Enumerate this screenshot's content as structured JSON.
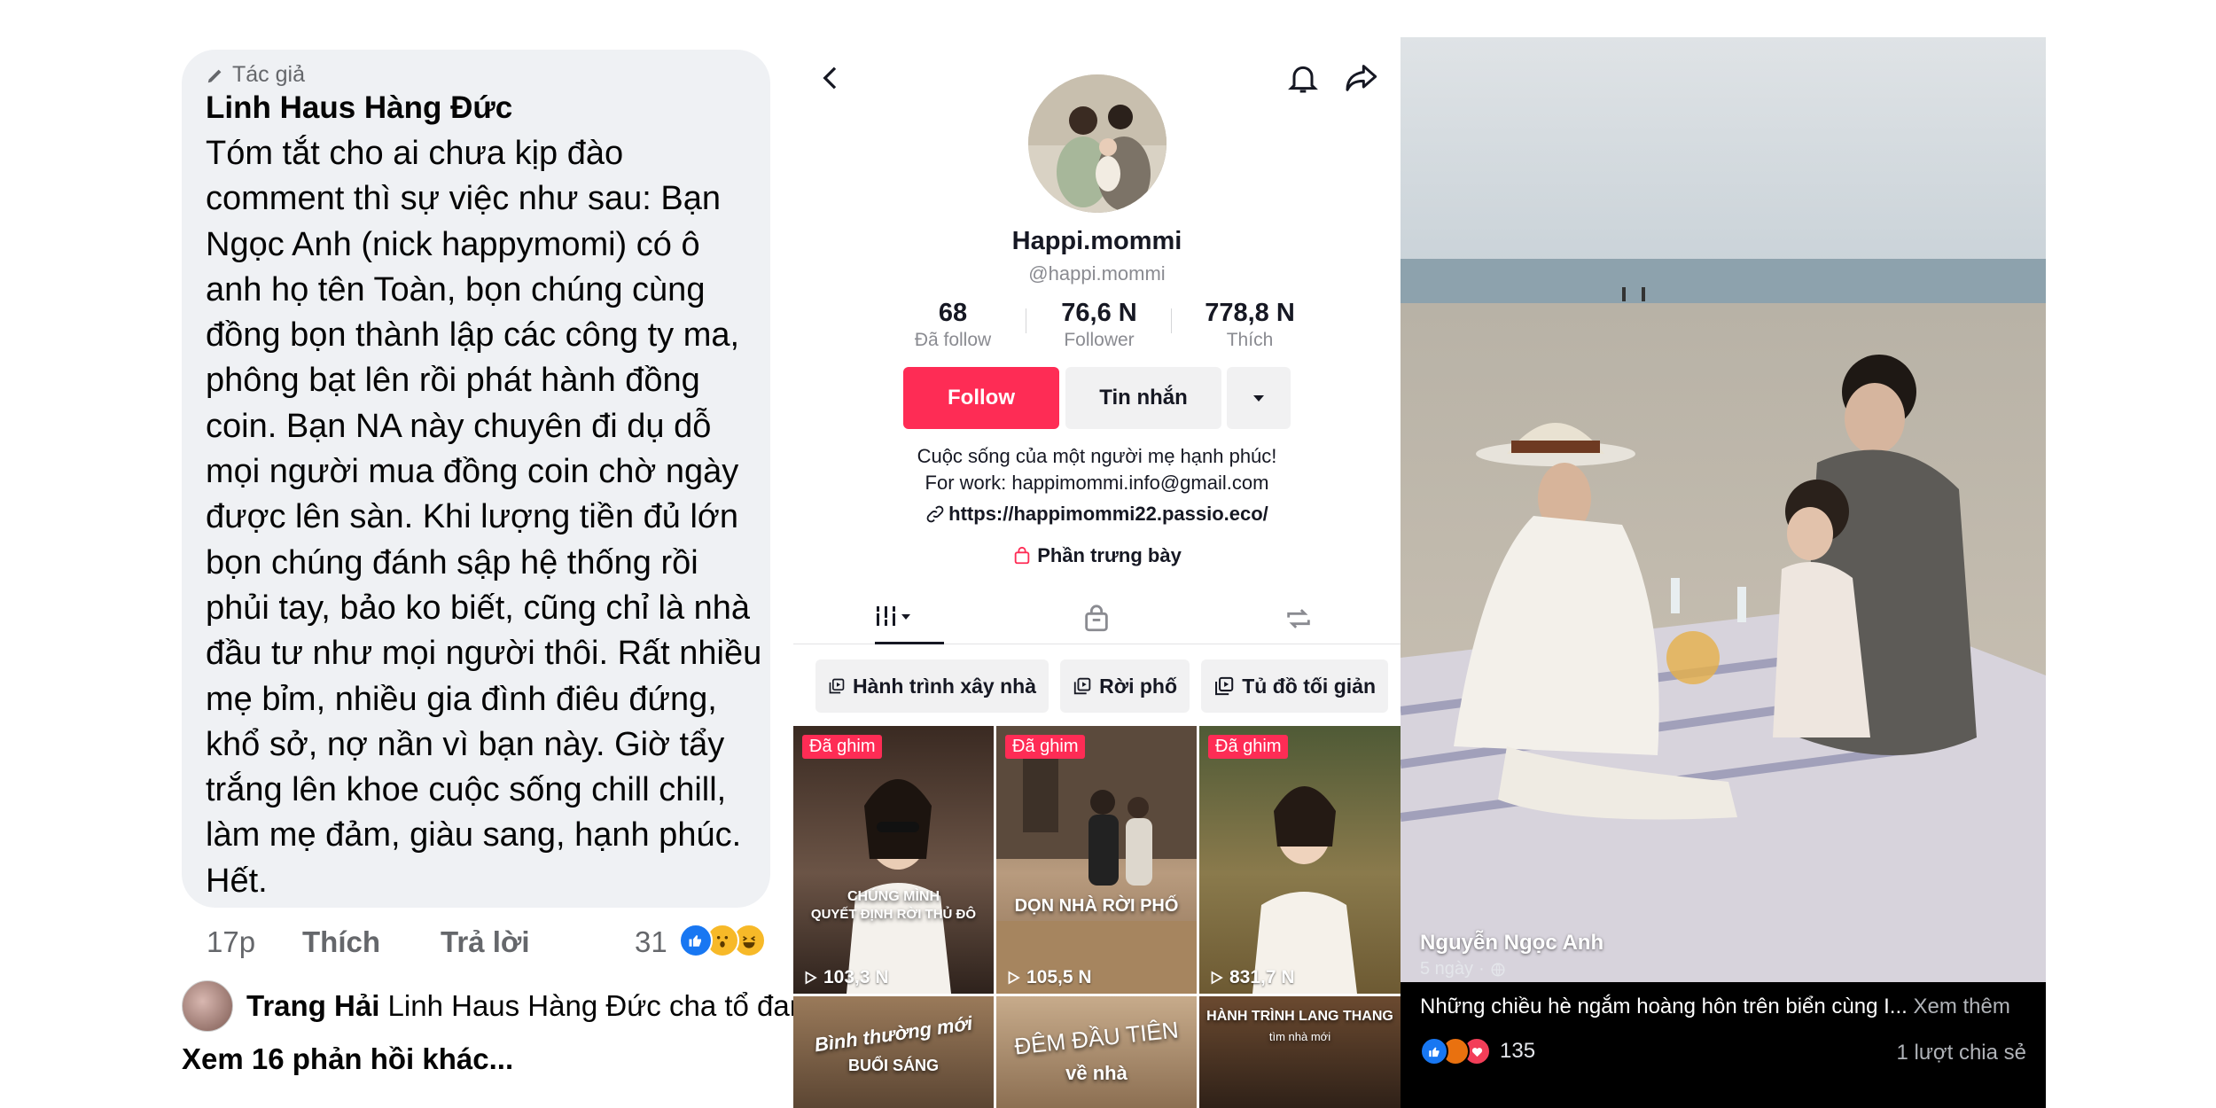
{
  "comment": {
    "author_badge": "Tác giả",
    "author_name": "Linh Haus Hàng Đức",
    "text": "Tóm tắt cho ai chưa kịp đào comment thì sự việc như sau: Bạn Ngọc Anh (nick happymomi) có ô anh họ tên Toàn, bọn chúng cùng đồng bọn thành lập các công ty ma, phông bạt lên rồi phát hành đồng coin. Bạn NA này chuyên đi dụ dỗ mọi người mua đồng coin chờ ngày được lên sàn. Khi lượng tiền đủ lớn bọn chúng đánh sập hệ thống rồi phủi tay, bảo ko biết, cũng chỉ là nhà đầu tư như mọi người thôi. Rất nhiều mẹ bỉm, nhiều gia đình điêu đứng, khổ sở, nợ nần vì bạn này. Giờ tẩy trắng lên khoe cuộc sống chill chill, làm mẹ đảm, giàu sang, hạnh phúc. Hết.",
    "time": "17p",
    "like_label": "Thích",
    "reply_label": "Trả lời",
    "reaction_count": "31",
    "reactions": [
      "like-icon",
      "wow-icon",
      "haha-icon"
    ]
  },
  "reply": {
    "author": "Trang Hải",
    "preview": "Linh Haus Hàng Đức cha tổ đan...",
    "more": "Xem 16 phản hồi khác..."
  },
  "tiktok": {
    "username": "Happi.mommi",
    "handle": "@happi.mommi",
    "stats": [
      {
        "value": "68",
        "label": "Đã follow"
      },
      {
        "value": "76,6 N",
        "label": "Follower"
      },
      {
        "value": "778,8 N",
        "label": "Thích"
      }
    ],
    "follow_label": "Follow",
    "message_label": "Tin nhắn",
    "bio_line1": "Cuộc sống của một người mẹ hạnh phúc!",
    "bio_line2": "For work: happimommi.info@gmail.com",
    "link": "https://happimommi22.passio.eco/",
    "showcase": "Phần trưng bày",
    "playlists": [
      "Hành trình xây nhà",
      "Rời phố",
      "Tủ đồ tối giản"
    ],
    "pinned_label": "Đã ghim",
    "videos": [
      {
        "views": "103,3 N",
        "overlay1": "CHÚNG MÌNH",
        "overlay2": "QUYẾT ĐỊNH RỜI THỦ ĐÔ"
      },
      {
        "views": "105,5 N",
        "overlay1": "DỌN NHÀ RỜI PHỐ",
        "overlay2": ""
      },
      {
        "views": "831,7 N",
        "overlay1": "",
        "overlay2": ""
      }
    ],
    "videos_row2": [
      "Bình thường mới",
      "BUỔI SÁNG",
      "ĐÊM ĐẦU TIÊN",
      "về nhà",
      "HÀNH TRÌNH LANG THANG",
      "tìm nhà mới"
    ]
  },
  "post": {
    "author": "Nguyễn Ngọc Anh",
    "time": "5 ngày",
    "caption": "Những chiều hè ngắm hoàng hôn trên biển cùng I...",
    "see_more": "Xem thêm",
    "reaction_count": "135",
    "shares": "1 lượt chia sẻ"
  }
}
